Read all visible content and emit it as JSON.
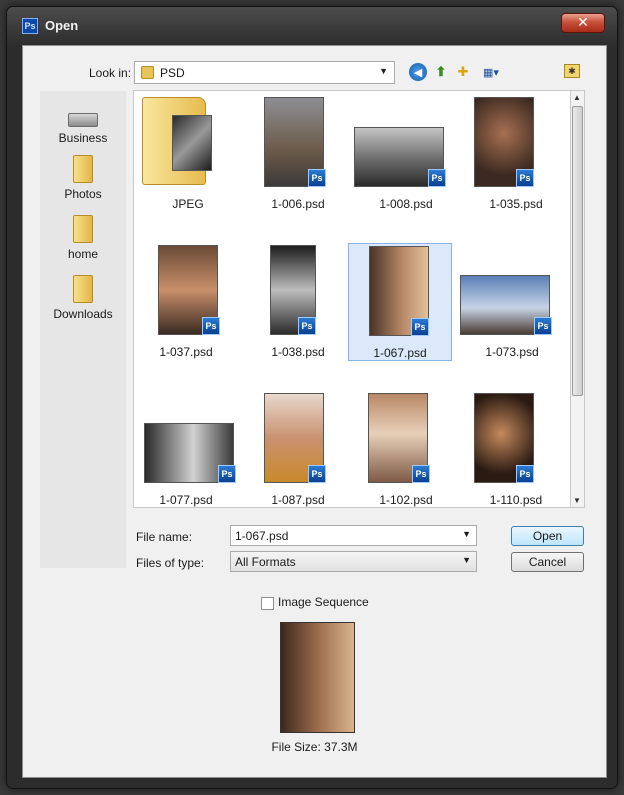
{
  "window": {
    "title": "Open",
    "app_icon": "Ps",
    "close_glyph": "✕"
  },
  "toolbar": {
    "look_in_label": "Look in:",
    "look_in_value": "PSD",
    "icons": [
      "back-icon",
      "up-folder-icon",
      "new-folder-icon",
      "view-menu-icon",
      "favorites-icon"
    ]
  },
  "places": [
    {
      "label": "Business",
      "icon": "drive-icon"
    },
    {
      "label": "Photos",
      "icon": "folder-icon"
    },
    {
      "label": "home",
      "icon": "folder-icon"
    },
    {
      "label": "Downloads",
      "icon": "folder-icon"
    }
  ],
  "files": [
    {
      "name": "JPEG",
      "type": "folder"
    },
    {
      "name": "1-006.psd",
      "type": "psd"
    },
    {
      "name": "1-008.psd",
      "type": "psd"
    },
    {
      "name": "1-035.psd",
      "type": "psd"
    },
    {
      "name": "1-037.psd",
      "type": "psd"
    },
    {
      "name": "1-038.psd",
      "type": "psd"
    },
    {
      "name": "1-067.psd",
      "type": "psd",
      "selected": true
    },
    {
      "name": "1-073.psd",
      "type": "psd"
    },
    {
      "name": "1-077.psd",
      "type": "psd"
    },
    {
      "name": "1-087.psd",
      "type": "psd"
    },
    {
      "name": "1-102.psd",
      "type": "psd"
    },
    {
      "name": "1-110.psd",
      "type": "psd"
    }
  ],
  "form": {
    "file_name_label": "File name:",
    "file_name_value": "1-067.psd",
    "files_of_type_label": "Files of type:",
    "files_of_type_value": "All Formats",
    "open_label": "Open",
    "cancel_label": "Cancel",
    "image_sequence_label": "Image Sequence",
    "image_sequence_checked": false
  },
  "preview": {
    "file_size_text": "File Size: 37.3M"
  },
  "ps_badge": "Ps"
}
